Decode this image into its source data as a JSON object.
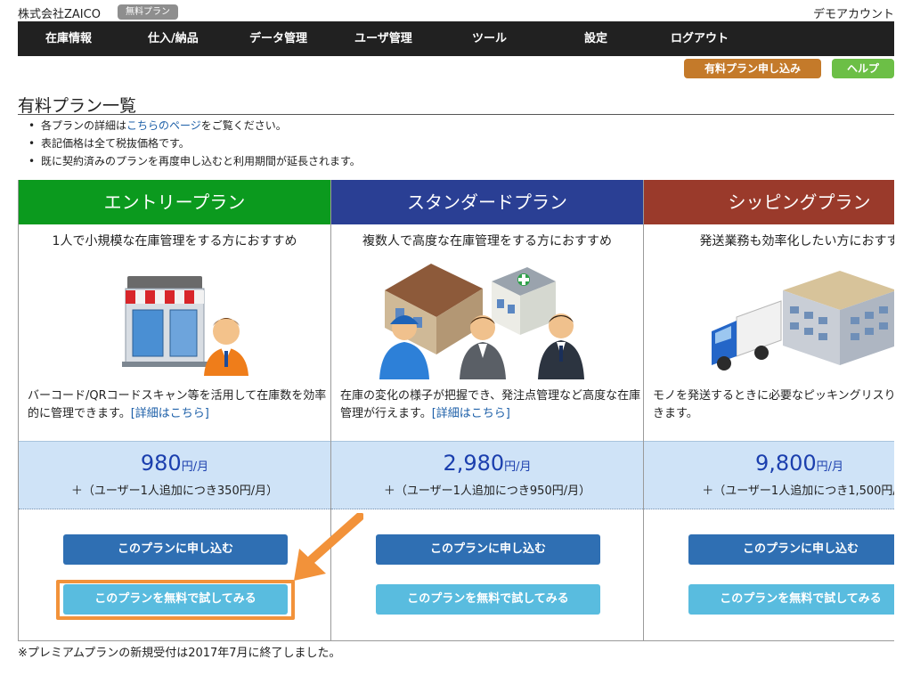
{
  "header": {
    "company": "株式会社ZAICO",
    "plan_badge": "無料プラン",
    "account": "デモアカウント"
  },
  "nav": {
    "items": [
      {
        "label": "在庫情報"
      },
      {
        "label": "仕入/納品"
      },
      {
        "label": "データ管理"
      },
      {
        "label": "ユーザ管理"
      },
      {
        "label": "ツール"
      },
      {
        "label": "設定"
      },
      {
        "label": "ログアウト"
      }
    ]
  },
  "actions": {
    "apply_label": "有料プラン申し込み",
    "help_label": "ヘルプ"
  },
  "page": {
    "title": "有料プラン一覧",
    "notes": {
      "note1_prefix": "各プランの詳細は",
      "note1_link": "こちらのページ",
      "note1_suffix": "をご覧ください。",
      "note2": "表記価格は全て税抜価格です。",
      "note3": "既に契約済みのプランを再度申し込むと利用期間が延長されます。"
    }
  },
  "colors": {
    "entry": "#0b9a1e",
    "standard": "#2a3f94",
    "shipping": "#9a3a2b",
    "nav_bg": "#212121",
    "price_bg": "#cfe3f7",
    "price_text": "#1b3fae",
    "apply_btn": "#c47a2a",
    "help_btn": "#6cbf46",
    "subscribe_btn": "#2f6fb3",
    "trial_btn": "#59bcdf",
    "highlight": "#f2923a"
  },
  "plans": [
    {
      "name": "エントリープラン",
      "tagline": "1人で小規模な在庫管理をする方におすすめ",
      "description": "バーコード/QRコードスキャン等を活用して在庫数を効率的に管理できます。",
      "details_link": "[詳細はこちら]",
      "price": "980",
      "price_unit": "円/月",
      "extra_user": "＋（ユーザー1人追加につき350円/月）",
      "subscribe_label": "このプランに申し込む",
      "trial_label": "このプランを無料で試してみる",
      "icon": "store-and-person-icon"
    },
    {
      "name": "スタンダードプラン",
      "tagline": "複数人で高度な在庫管理をする方におすすめ",
      "description": "在庫の変化の様子が把握でき、発注点管理など高度な在庫管理が行えます。",
      "details_link": "[詳細はこちら]",
      "price": "2,980",
      "price_unit": "円/月",
      "extra_user": "＋（ユーザー1人追加につき950円/月）",
      "subscribe_label": "このプランに申し込む",
      "trial_label": "このプランを無料で試してみる",
      "icon": "buildings-and-team-icon"
    },
    {
      "name": "シッピングプラン",
      "tagline": "発送業務も効率化したい方におすす",
      "description": "モノを発送するときに必要なピッキングリスり状を作成できます。",
      "details_link": "",
      "price": "9,800",
      "price_unit": "円/月",
      "extra_user": "＋（ユーザー1人追加につき1,500円/",
      "subscribe_label": "このプランに申し込む",
      "trial_label": "このプランを無料で試してみる",
      "icon": "truck-and-warehouse-icon"
    }
  ],
  "footer": {
    "note": "※プレミアムプランの新規受付は2017年7月に終了しました。"
  }
}
